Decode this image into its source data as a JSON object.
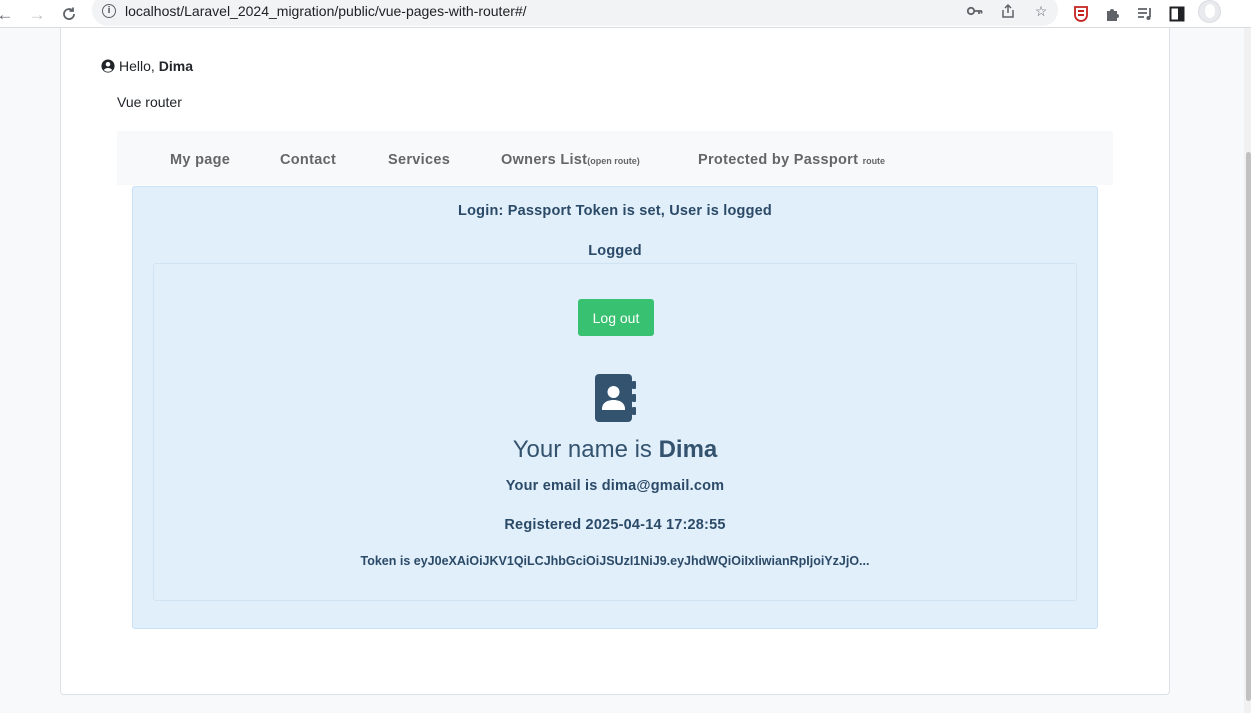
{
  "browser": {
    "url": "localhost/Laravel_2024_migration/public/vue-pages-with-router#/"
  },
  "header": {
    "hello_label": "Hello,",
    "user_name": "Dima",
    "app_title": "Vue router"
  },
  "navbar": {
    "items": [
      {
        "label": "My page",
        "suffix": ""
      },
      {
        "label": "Contact",
        "suffix": ""
      },
      {
        "label": "Services",
        "suffix": ""
      },
      {
        "label": "Owners List",
        "suffix": "(open route)"
      },
      {
        "label": "Protected by Passport",
        "suffix": "route"
      }
    ]
  },
  "login": {
    "status": "Login: Passport Token is set, User is logged",
    "state": "Logged",
    "logout_label": "Log out",
    "name_prefix": "Your name is",
    "name": "Dima",
    "email_line": "Your email is dima@gmail.com",
    "registered_line": "Registered 2025-04-14 17:28:55",
    "token_line": "Token is eyJ0eXAiOiJKV1QiLCJhbGciOiJSUzI1NiJ9.eyJhdWQiOiIxIiwianRpIjoiYzJjO..."
  },
  "colors": {
    "alert_bg": "#e1effa",
    "button_green": "#37c170",
    "text_dark_blue": "#2b4a68"
  }
}
